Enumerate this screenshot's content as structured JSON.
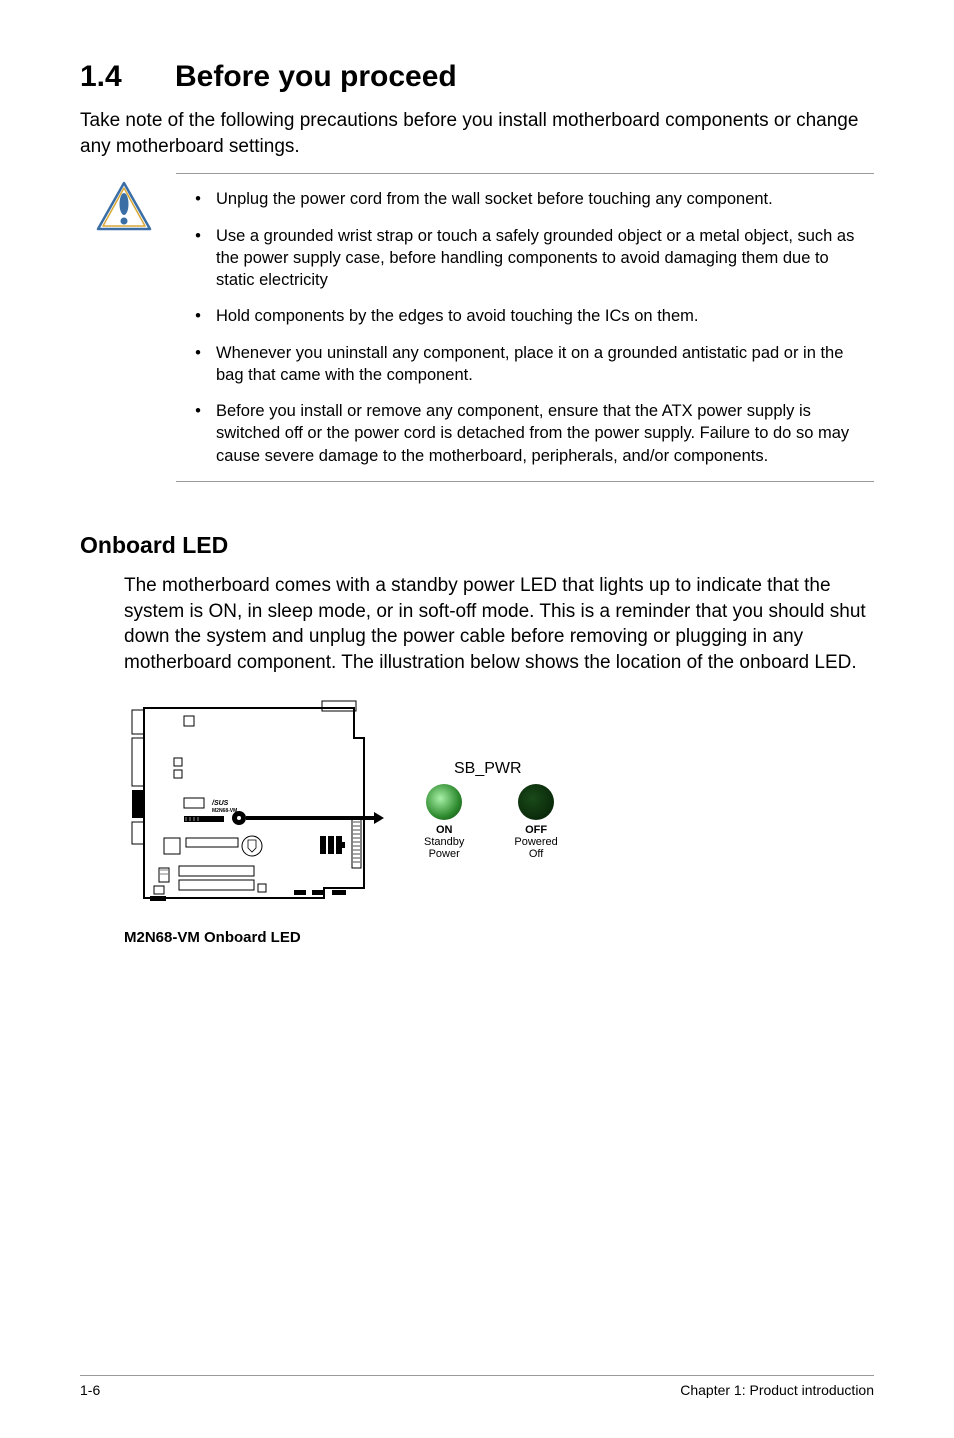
{
  "heading": {
    "number": "1.4",
    "title": "Before you proceed"
  },
  "intro": "Take note of the following precautions before you install motherboard components or change any motherboard settings.",
  "caution": [
    "Unplug the power cord from the wall socket before touching any component.",
    "Use a grounded wrist strap or touch a safely grounded object or a metal object, such as the power supply case, before handling components to avoid damaging them due to static electricity",
    "Hold components by the edges to avoid touching the ICs on them.",
    "Whenever you uninstall any component, place it on a grounded antistatic pad or in the bag that came with the component.",
    "Before you install or remove any component, ensure that the ATX power supply is switched off or the power cord is detached from the power supply. Failure to do so may cause severe damage to the motherboard, peripherals, and/or components."
  ],
  "onboard": {
    "heading": "Onboard LED",
    "body": "The motherboard comes with a standby power LED that lights up to indicate that the system is ON, in sleep mode, or in soft-off mode. This is a reminder that you should shut down the system and unplug the power cable before removing or plugging in any motherboard component. The illustration below shows the location of the onboard LED."
  },
  "diagram": {
    "board_label": "M2N68-VM",
    "sb_pwr": "SB_PWR",
    "on_bold": "ON",
    "on_sub": "Standby\nPower",
    "off_bold": "OFF",
    "off_sub": "Powered\nOff",
    "caption": "M2N68-VM Onboard LED"
  },
  "footer": {
    "left": "1-6",
    "right": "Chapter 1: Product introduction"
  }
}
